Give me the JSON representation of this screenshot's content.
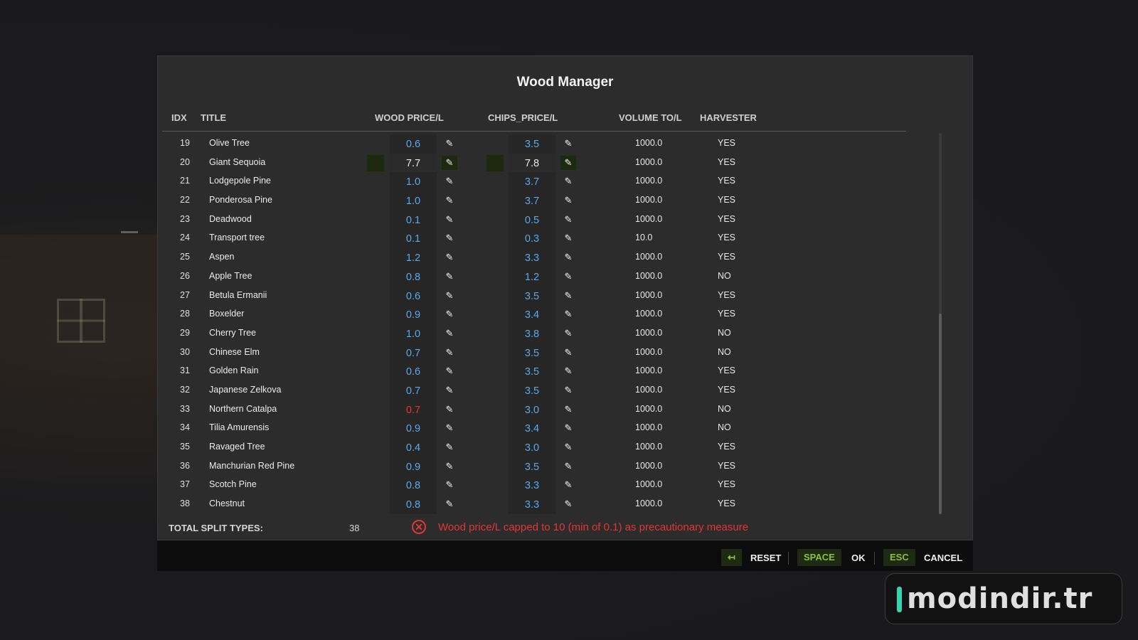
{
  "dialog": {
    "title": "Wood Manager"
  },
  "columns": {
    "idx": "IDX",
    "title": "TITLE",
    "wood_price": "WOOD PRICE/L",
    "chips_price": "CHIPS_PRICE/L",
    "volume": "VOLUME TO/L",
    "harvester": "HARVESTER"
  },
  "rows": [
    {
      "idx": "19",
      "title": "Olive Tree",
      "wood": "0.6",
      "chips": "3.5",
      "volume": "1000.0",
      "harvester": "YES"
    },
    {
      "idx": "20",
      "title": "Giant Sequoia",
      "wood": "7.7",
      "chips": "7.8",
      "volume": "1000.0",
      "harvester": "YES",
      "selected": true
    },
    {
      "idx": "21",
      "title": "Lodgepole Pine",
      "wood": "1.0",
      "chips": "3.7",
      "volume": "1000.0",
      "harvester": "YES"
    },
    {
      "idx": "22",
      "title": "Ponderosa Pine",
      "wood": "1.0",
      "chips": "3.7",
      "volume": "1000.0",
      "harvester": "YES"
    },
    {
      "idx": "23",
      "title": "Deadwood",
      "wood": "0.1",
      "chips": "0.5",
      "volume": "1000.0",
      "harvester": "YES"
    },
    {
      "idx": "24",
      "title": "Transport tree",
      "wood": "0.1",
      "chips": "0.3",
      "volume": "10.0",
      "harvester": "YES"
    },
    {
      "idx": "25",
      "title": "Aspen",
      "wood": "1.2",
      "chips": "3.3",
      "volume": "1000.0",
      "harvester": "YES"
    },
    {
      "idx": "26",
      "title": "Apple Tree",
      "wood": "0.8",
      "chips": "1.2",
      "volume": "1000.0",
      "harvester": "NO"
    },
    {
      "idx": "27",
      "title": "Betula Ermanii",
      "wood": "0.6",
      "chips": "3.5",
      "volume": "1000.0",
      "harvester": "YES"
    },
    {
      "idx": "28",
      "title": "Boxelder",
      "wood": "0.9",
      "chips": "3.4",
      "volume": "1000.0",
      "harvester": "YES"
    },
    {
      "idx": "29",
      "title": "Cherry Tree",
      "wood": "1.0",
      "chips": "3.8",
      "volume": "1000.0",
      "harvester": "NO"
    },
    {
      "idx": "30",
      "title": "Chinese Elm",
      "wood": "0.7",
      "chips": "3.5",
      "volume": "1000.0",
      "harvester": "NO"
    },
    {
      "idx": "31",
      "title": "Golden Rain",
      "wood": "0.6",
      "chips": "3.5",
      "volume": "1000.0",
      "harvester": "YES"
    },
    {
      "idx": "32",
      "title": "Japanese Zelkova",
      "wood": "0.7",
      "chips": "3.5",
      "volume": "1000.0",
      "harvester": "YES"
    },
    {
      "idx": "33",
      "title": "Northern Catalpa",
      "wood": "0.7",
      "chips": "3.0",
      "volume": "1000.0",
      "harvester": "NO",
      "error": true
    },
    {
      "idx": "34",
      "title": "Tilia Amurensis",
      "wood": "0.9",
      "chips": "3.4",
      "volume": "1000.0",
      "harvester": "NO"
    },
    {
      "idx": "35",
      "title": "Ravaged Tree",
      "wood": "0.4",
      "chips": "3.0",
      "volume": "1000.0",
      "harvester": "YES"
    },
    {
      "idx": "36",
      "title": "Manchurian Red Pine",
      "wood": "0.9",
      "chips": "3.5",
      "volume": "1000.0",
      "harvester": "YES"
    },
    {
      "idx": "37",
      "title": "Scotch Pine",
      "wood": "0.8",
      "chips": "3.3",
      "volume": "1000.0",
      "harvester": "YES"
    },
    {
      "idx": "38",
      "title": "Chestnut",
      "wood": "0.8",
      "chips": "3.3",
      "volume": "1000.0",
      "harvester": "YES"
    }
  ],
  "footer": {
    "total_label": "TOTAL SPLIT TYPES:",
    "total_value": "38",
    "error_message": "Wood price/L capped to 10 (min of 0.1) as precautionary measure"
  },
  "buttons": {
    "reset_key": "↤",
    "reset_label": "RESET",
    "ok_key": "SPACE",
    "ok_label": "OK",
    "cancel_key": "ESC",
    "cancel_label": "CANCEL"
  },
  "watermark": {
    "text": "modindir.tr"
  },
  "icons": {
    "edit": "pencil-icon",
    "error": "error-circle-x-icon",
    "reset": "back-arrow-icon"
  },
  "colors": {
    "value_blue": "#5aa9ea",
    "error_red": "#e23535",
    "key_green": "#8fbf3a",
    "selected_green": "#1e2a0f"
  }
}
